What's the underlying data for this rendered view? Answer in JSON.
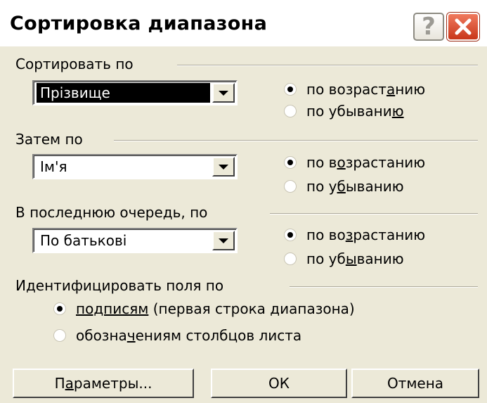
{
  "window": {
    "title": "Сортировка диапазона",
    "help_glyph": "?",
    "close_glyph": "✕"
  },
  "sort_by": {
    "group_label": "Сортировать по",
    "field_value": "Прізвище",
    "ascending_label": "по возраст|а|нию",
    "descending_label": "по убывани|ю|",
    "selected": "ascending"
  },
  "then_by": {
    "group_label": "Затем по",
    "field_value": "Ім'я",
    "ascending_label": "по в|о|зрастанию",
    "descending_label": "по у|б|ыванию",
    "selected": "ascending"
  },
  "last_by": {
    "group_label": "В последнюю очередь, по",
    "field_value": "По батькові",
    "ascending_label": "по во|з|растанию",
    "descending_label": "по уб|ы|ванию",
    "selected": "ascending"
  },
  "identify": {
    "group_label": "Идентифицировать поля по",
    "option_labels_label": "|подписям| (первая строка диапазона)",
    "option_columns_label": "обозна|ч|ениям столбцов листа",
    "selected": "labels"
  },
  "buttons": {
    "options_label": "П|а|раметры...",
    "ok_label": "ОК",
    "cancel_label": "Отмена"
  },
  "icons": {
    "help": "help-icon",
    "close": "close-icon",
    "dropdown": "chevron-down-icon"
  },
  "colors": {
    "dialog_bg": "#ece9d8",
    "close_button": "#d9472b",
    "selection_bg": "#000000"
  }
}
